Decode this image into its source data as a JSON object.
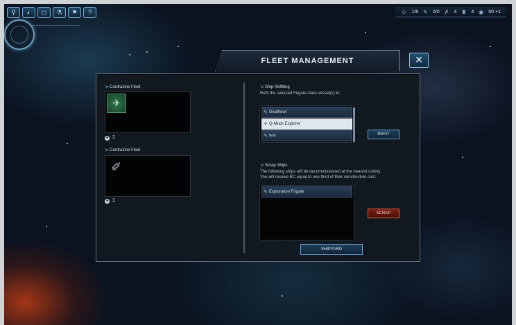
{
  "hud": {
    "toolbar_icons": [
      "ship-icon",
      "planet-icon",
      "chat-icon",
      "research-icon",
      "diplomacy-icon",
      "info-icon"
    ],
    "resources": [
      {
        "icon": "population-icon",
        "value": "1/6"
      },
      {
        "icon": "research-icon",
        "value": "0/0"
      },
      {
        "icon": "influence-icon",
        "value": "4"
      },
      {
        "icon": "industry-icon",
        "value": "4"
      },
      {
        "icon": "credits-icon",
        "value": "50 +1"
      }
    ]
  },
  "window": {
    "title": "FLEET MANAGEMENT",
    "close_label": "✕"
  },
  "fleets": [
    {
      "name": "Cordrazine Fleet",
      "count": "1",
      "thumbnail": "frigate-icon"
    },
    {
      "name": "Cordrazine Fleet",
      "count": "1",
      "thumbnail": "scout-ship-icon"
    }
  ],
  "refit": {
    "heading": "Ship Refitting",
    "description": "Refit the selected Frigate class vessel(s) to:",
    "options": [
      {
        "label": "Deathowl",
        "selected": false
      },
      {
        "label": "Q-Muck Explorer",
        "selected": true
      },
      {
        "label": "test",
        "selected": false
      }
    ],
    "button_label": "REFIT"
  },
  "scrap": {
    "heading": "Scrap Ships",
    "description_line1": "The following ships will be decommissioned at the nearest colony.",
    "description_line2": "You will receive BC equal to one third of their construction cost.",
    "items": [
      "Exploration Frigate"
    ],
    "button_label": "SCRAP"
  },
  "shipyard_button_label": "SHIPYARD"
}
